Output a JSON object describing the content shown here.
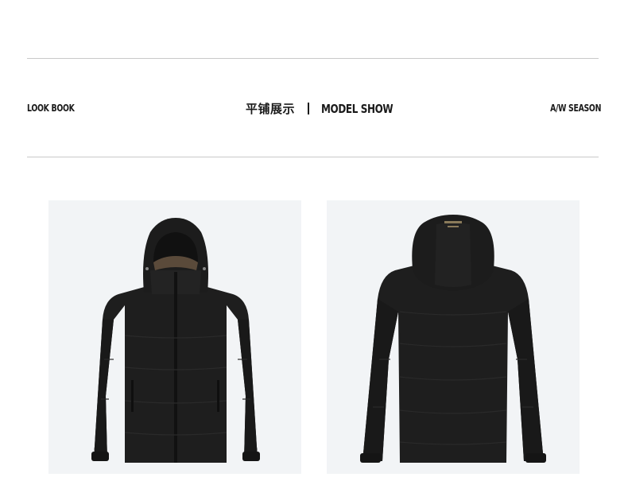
{
  "header": {
    "left_label": "LOOK BOOK",
    "center_cn": "平铺展示",
    "center_en": "MODEL SHOW",
    "right_label": "A/W SEASON"
  },
  "photos": [
    {
      "view": "front",
      "subject": "black hooded down jacket front view"
    },
    {
      "view": "back",
      "subject": "black hooded down jacket back view"
    }
  ],
  "colors": {
    "background": "#ffffff",
    "rule": "#c9c9c9",
    "panel": "#f2f4f6",
    "jacket": "#1e1e1e",
    "lining": "#5a4a3a"
  }
}
